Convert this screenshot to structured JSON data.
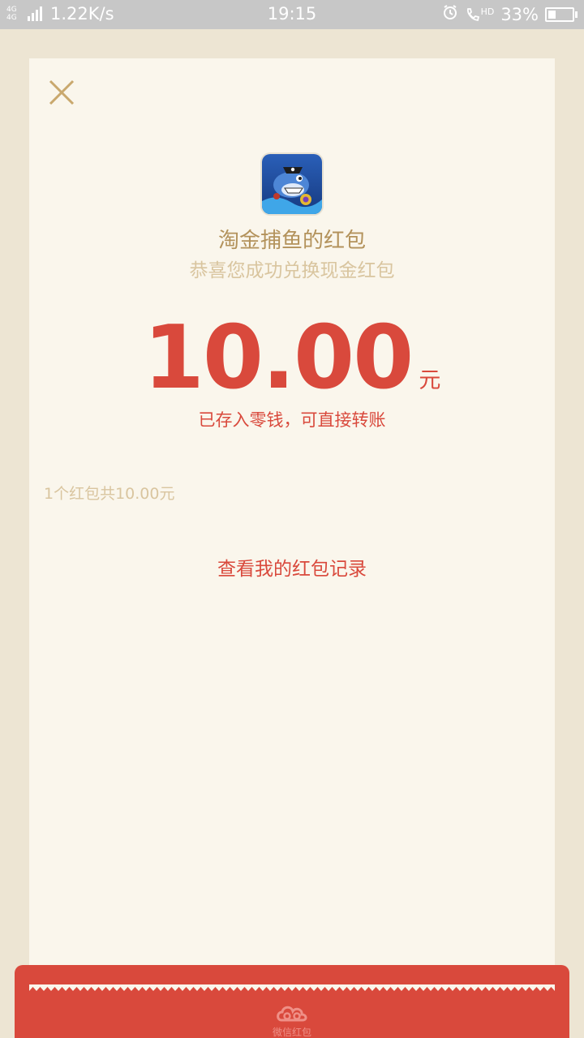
{
  "status_bar": {
    "network_type": "4G 4G",
    "speed": "1.22K/s",
    "time": "19:15",
    "hd_label": "HD",
    "battery_percent": "33%",
    "battery_level": 0.33
  },
  "card": {
    "close_icon": "close-icon",
    "sender_name": "淘金捕鱼的红包",
    "subtitle": "恭喜您成功兑换现金红包",
    "amount": "10.00",
    "amount_unit": "元",
    "stored_note": "已存入零钱，可直接转账",
    "summary": "1个红包共10.00元",
    "history_link": "查看我的红包记录"
  },
  "footer": {
    "logo_icon": "cloud-logo-icon",
    "text": "微信红包"
  },
  "colors": {
    "accent_red": "#d9493c",
    "gold_text": "#b3925b",
    "pale_gold_text": "#d9c59f",
    "card_bg": "#faf6ec",
    "page_bg": "#ede5d3"
  }
}
